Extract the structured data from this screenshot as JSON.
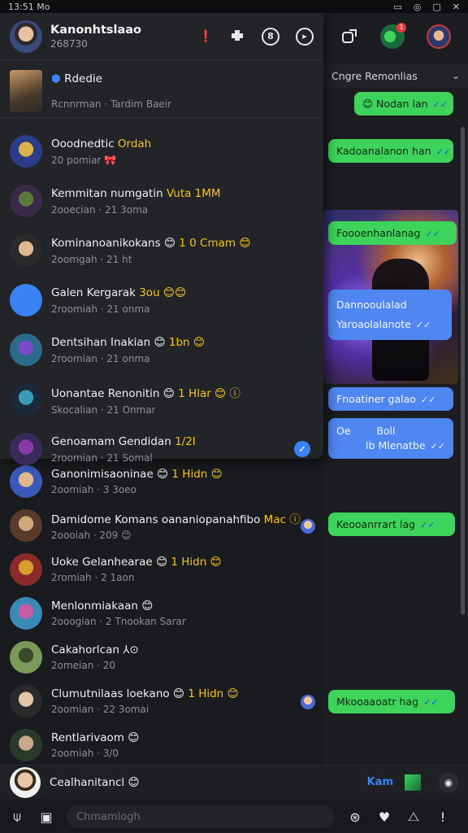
{
  "status_bar": {
    "time": "13:51 Mo",
    "icons": [
      "▭",
      "◎",
      "▢",
      "✕"
    ]
  },
  "header": {
    "title": "Kanonhtslaao",
    "subtitle": "268730",
    "icons": [
      "alert-icon",
      "puzzle-icon",
      "status-icon",
      "play-icon"
    ]
  },
  "chat_header": {
    "filter_label": "Cngre Remonlias"
  },
  "pinned": {
    "name": "Rdedie",
    "sub": "Rcnnrman · Tardim Baeir"
  },
  "contacts": [
    {
      "name": "Ooodnedtic ",
      "highlight": "Ordah",
      "sub": "20 pomiar 🎀",
      "avatar_colors": [
        "#d8b24a",
        "#2a3c8a"
      ]
    },
    {
      "name": "Kemmitan numgatin ",
      "highlight": "Vuta 1MM",
      "sub": "2ooecian · 21 3oma",
      "avatar_colors": [
        "#5a7a3a",
        "#3a2a4a"
      ]
    },
    {
      "name": "Kominanoanikokans 😊 ",
      "highlight": "1 0 Cmam 😊",
      "sub": "2oomgah · 21 ht",
      "avatar_colors": [
        "#e0b890",
        "#2a2a2a"
      ]
    },
    {
      "name": "Galen Kergarak ",
      "highlight": "3ou 😊😊",
      "sub": "2roomiah · 21 onma",
      "avatar_colors": [
        "#3b82f6",
        "#3b82f6"
      ]
    },
    {
      "name": "Dentsihan Inakian 😊 ",
      "highlight": "1bn 😊",
      "sub": "2roomian · 21 onma",
      "avatar_colors": [
        "#7a4ac8",
        "#2a6a8a"
      ]
    },
    {
      "name": "Uonantae Renonitin 😊 ",
      "highlight": "1 Hlar 😊 ⓘ",
      "sub": "Skocalian · 21 Onmar",
      "avatar_colors": [
        "#3a9ab8",
        "#1a2a3a"
      ]
    },
    {
      "name": "Genoamam Gendidan ",
      "highlight": "1/2I",
      "sub": "2roomian · 21 Somal",
      "avatar_colors": [
        "#8a3aa8",
        "#3a2a5a"
      ],
      "checked": true
    }
  ],
  "contacts_lower": [
    {
      "name": "Ganonimisaoninae 😊 ",
      "highlight": "1 Hidn 😊",
      "sub": "2oomiah · 3 3oeo",
      "avatar_colors": [
        "#e0b890",
        "#3a5ab8"
      ]
    },
    {
      "name": "Damidome Komans oananiopanahfibo ",
      "highlight": "Mac ⓘ",
      "sub": "2oooiah · 209 😊",
      "avatar_colors": [
        "#d0a880",
        "#5a3a2a"
      ],
      "mini": true
    },
    {
      "name": "Uoke Gelanhearae 😊 ",
      "highlight": "1 Hidn 😊",
      "sub": "2romiah · 2 1aon",
      "avatar_colors": [
        "#d8a02a",
        "#8a2a2a"
      ]
    },
    {
      "name": "Menlonmiakaan 😊",
      "highlight": "",
      "sub": "2ooogian · 2 Tnookan Sarar",
      "avatar_colors": [
        "#c85aa8",
        "#3a8ab8"
      ]
    },
    {
      "name": "Cakahorlcan ⅄⊙",
      "highlight": "",
      "sub": "2omeian · 20",
      "avatar_colors": [
        "#3a4a2a",
        "#7a9a5a"
      ]
    },
    {
      "name": "Clumutnilaas loekano 😊 ",
      "highlight": "1 Hidn 😊",
      "sub": "2oomian · 22 3omai",
      "avatar_colors": [
        "#e0c8a8",
        "#2a2a2a"
      ],
      "mini": true
    },
    {
      "name": "Rentlarivaom 😊",
      "highlight": "",
      "sub": "2oomiah · 3/0",
      "avatar_colors": [
        "#c8a888",
        "#2a3a2a"
      ]
    }
  ],
  "messages": [
    {
      "text": "😊 Nodan lan",
      "color": "green"
    },
    {
      "text": "Kadoanalanon han",
      "color": "green"
    },
    {
      "text": "Foooenhanlanag",
      "color": "green"
    },
    {
      "text": "Dannooulalad",
      "color": "blue"
    },
    {
      "text": "Yaroaolalanote",
      "color": "blue"
    },
    {
      "text": "Fnoatiner galao",
      "color": "blue"
    },
    {
      "text": "Oe        Boll",
      "color": "blue"
    },
    {
      "text": "Ib Mlenatbe",
      "color": "blue"
    },
    {
      "text": "Keooanrrart lag",
      "color": "green"
    },
    {
      "text": "Mkooaaoatr hag",
      "color": "green"
    }
  ],
  "reply": {
    "name": "Cealhanitancl 😊",
    "send_label": "Kam"
  },
  "input": {
    "placeholder": "Chmamlogh"
  }
}
